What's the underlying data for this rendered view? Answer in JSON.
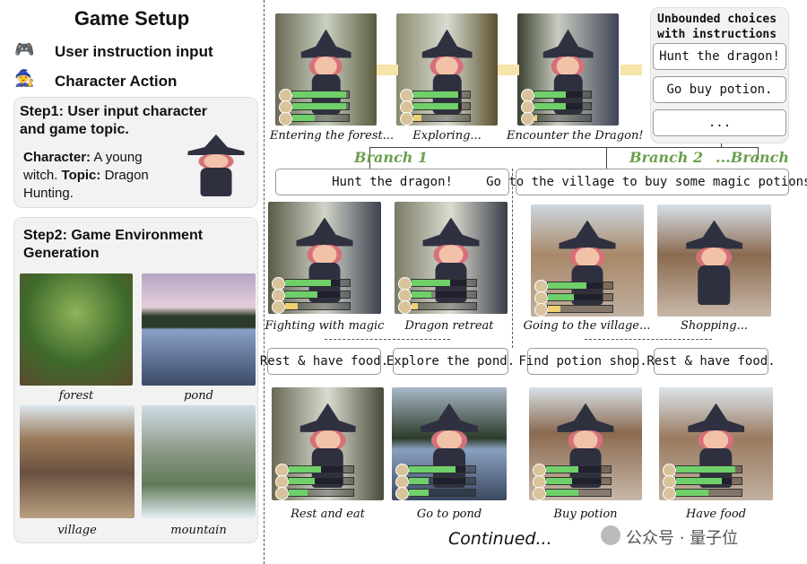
{
  "setup": {
    "title": "Game Setup",
    "legend": [
      {
        "icon": "gamepad-icon",
        "label": "User instruction input"
      },
      {
        "icon": "character-icon",
        "label": "Character Action"
      }
    ],
    "step1": {
      "title": "Step1: User input character and game topic.",
      "character_label": "Character:",
      "character_value": " A young witch. ",
      "topic_label": "Topic:",
      "topic_value": " Dragon Hunting."
    },
    "step2": {
      "title": "Step2: Game Environment Generation",
      "environments": [
        "forest",
        "pond",
        "village",
        "mountain"
      ]
    }
  },
  "top": {
    "captions": [
      "Entering the forest...",
      "Exploring...",
      "Encounter the Dragon!"
    ],
    "choices": {
      "title": "Unbounded choices with instructions",
      "items": [
        "Hunt the dragon!",
        "Go buy potion.",
        "..."
      ]
    }
  },
  "branches": [
    "Branch 1",
    "Branch 2",
    "...Branch N"
  ],
  "branch1": {
    "instruction": "Hunt the dragon!",
    "captions": [
      "Fighting with magic",
      "Dragon retreat"
    ],
    "sub_instructions": [
      "Rest & have food.",
      "Explore the pond."
    ],
    "sub_captions": [
      "Rest and eat",
      "Go to pond"
    ]
  },
  "branch2": {
    "instruction": "Go to the village to buy some magic potions.",
    "captions": [
      "Going to the village...",
      "Shopping..."
    ],
    "sub_instructions": [
      "Find potion shop.",
      "Rest & have food."
    ],
    "sub_captions": [
      "Buy potion",
      "Have food"
    ]
  },
  "footer": {
    "continued": "Continued...",
    "watermark": "公众号 · 量子位"
  },
  "status_bars": {
    "top": [
      [
        0.95,
        0.95,
        0.4
      ],
      [
        0.8,
        0.8,
        0.15
      ],
      [
        0.55,
        0.55,
        0.05
      ]
    ],
    "colors": {
      "bar": "#6fd06a",
      "branch": "#6aa04e"
    }
  }
}
